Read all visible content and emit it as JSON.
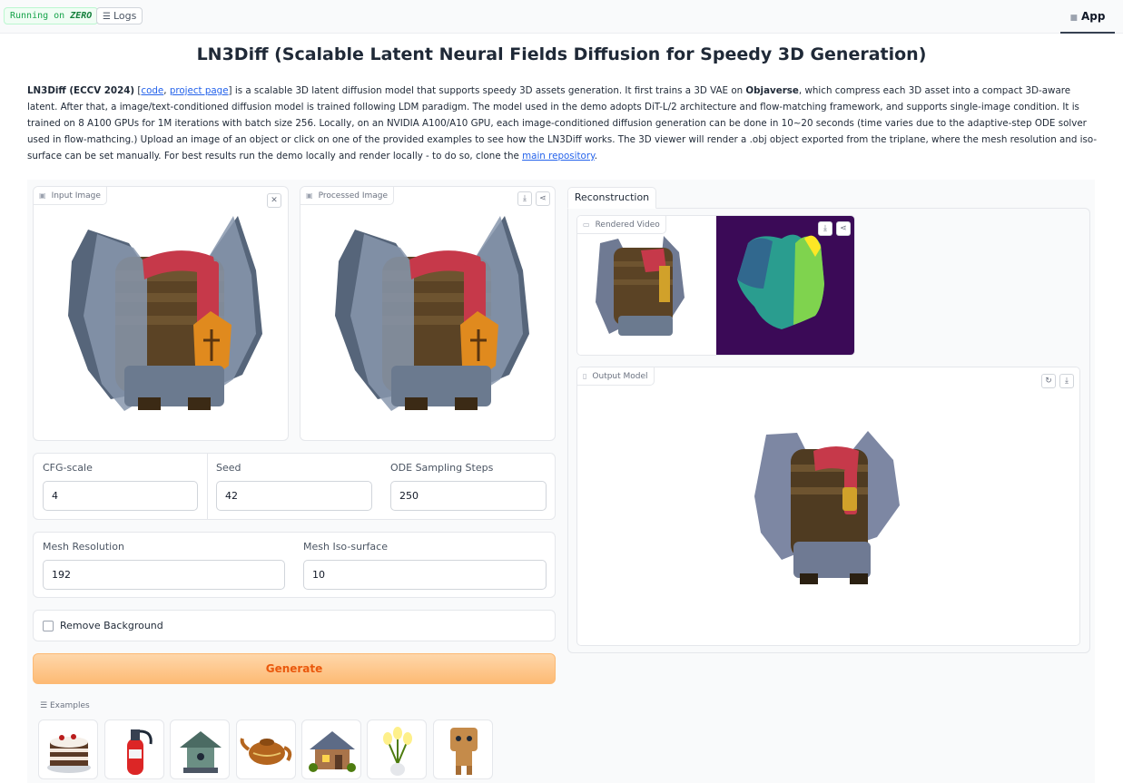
{
  "header": {
    "running_prefix": "Running on",
    "running_badge": "ZERO",
    "logs_label": "Logs",
    "app_tab": "App"
  },
  "title": "LN3Diff (Scalable Latent Neural Fields Diffusion for Speedy 3D Generation)",
  "description": {
    "bold_name": "LN3Diff (ECCV 2024)",
    "link_code": "code",
    "link_project": "project page",
    "text1": " is a scalable 3D latent diffusion model that supports speedy 3D assets generation. It first trains a 3D VAE on ",
    "bold_dataset": "Objaverse",
    "text2": ", which compress each 3D asset into a compact 3D-aware latent. After that, a image/text-conditioned diffusion model is trained following LDM paradigm. The model used in the demo adopts DiT-L/2 architecture and flow-matching framework, and supports single-image condition. It is trained on 8 A100 GPUs for 1M iterations with batch size 256. Locally, on an NVIDIA A100/A10 GPU, each image-conditioned diffusion generation can be done in 10~20 seconds (time varies due to the adaptive-step ODE solver used in flow-mathcing.) Upload an image of an object or click on one of the provided examples to see how the LN3Diff works. The 3D viewer will render a .obj object exported from the triplane, where the mesh resolution and iso-surface can be set manually. For best results run the demo locally and render locally - to do so, clone the ",
    "link_repo": "main repository",
    "text3": "."
  },
  "input_image": {
    "label": "Input Image"
  },
  "processed_image": {
    "label": "Processed Image"
  },
  "params": {
    "cfg": {
      "label": "CFG-scale",
      "value": "4"
    },
    "seed": {
      "label": "Seed",
      "value": "42"
    },
    "ode": {
      "label": "ODE Sampling Steps",
      "value": "250"
    },
    "mesh_res": {
      "label": "Mesh Resolution",
      "value": "192"
    },
    "iso": {
      "label": "Mesh Iso-surface",
      "value": "10"
    }
  },
  "remove_bg": {
    "label": "Remove Background",
    "checked": false
  },
  "generate_label": "Generate",
  "examples_label": "Examples",
  "examples": [
    "cake",
    "fire-extinguisher",
    "birdhouse",
    "teapot",
    "cottage",
    "tulip-vase",
    "robot-toy"
  ],
  "reconstruction_tab": "Reconstruction",
  "rendered_video": {
    "label": "Rendered Video"
  },
  "output_model": {
    "label": "Output Model"
  }
}
